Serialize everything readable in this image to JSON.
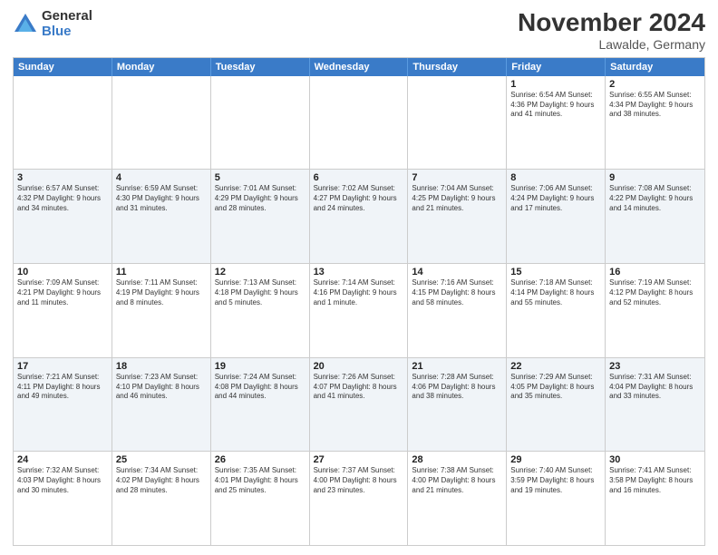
{
  "logo": {
    "general": "General",
    "blue": "Blue"
  },
  "header": {
    "month": "November 2024",
    "location": "Lawalde, Germany"
  },
  "weekdays": [
    "Sunday",
    "Monday",
    "Tuesday",
    "Wednesday",
    "Thursday",
    "Friday",
    "Saturday"
  ],
  "rows": [
    {
      "alt": false,
      "cells": [
        {
          "day": "",
          "info": ""
        },
        {
          "day": "",
          "info": ""
        },
        {
          "day": "",
          "info": ""
        },
        {
          "day": "",
          "info": ""
        },
        {
          "day": "",
          "info": ""
        },
        {
          "day": "1",
          "info": "Sunrise: 6:54 AM\nSunset: 4:36 PM\nDaylight: 9 hours and 41 minutes."
        },
        {
          "day": "2",
          "info": "Sunrise: 6:55 AM\nSunset: 4:34 PM\nDaylight: 9 hours and 38 minutes."
        }
      ]
    },
    {
      "alt": true,
      "cells": [
        {
          "day": "3",
          "info": "Sunrise: 6:57 AM\nSunset: 4:32 PM\nDaylight: 9 hours and 34 minutes."
        },
        {
          "day": "4",
          "info": "Sunrise: 6:59 AM\nSunset: 4:30 PM\nDaylight: 9 hours and 31 minutes."
        },
        {
          "day": "5",
          "info": "Sunrise: 7:01 AM\nSunset: 4:29 PM\nDaylight: 9 hours and 28 minutes."
        },
        {
          "day": "6",
          "info": "Sunrise: 7:02 AM\nSunset: 4:27 PM\nDaylight: 9 hours and 24 minutes."
        },
        {
          "day": "7",
          "info": "Sunrise: 7:04 AM\nSunset: 4:25 PM\nDaylight: 9 hours and 21 minutes."
        },
        {
          "day": "8",
          "info": "Sunrise: 7:06 AM\nSunset: 4:24 PM\nDaylight: 9 hours and 17 minutes."
        },
        {
          "day": "9",
          "info": "Sunrise: 7:08 AM\nSunset: 4:22 PM\nDaylight: 9 hours and 14 minutes."
        }
      ]
    },
    {
      "alt": false,
      "cells": [
        {
          "day": "10",
          "info": "Sunrise: 7:09 AM\nSunset: 4:21 PM\nDaylight: 9 hours and 11 minutes."
        },
        {
          "day": "11",
          "info": "Sunrise: 7:11 AM\nSunset: 4:19 PM\nDaylight: 9 hours and 8 minutes."
        },
        {
          "day": "12",
          "info": "Sunrise: 7:13 AM\nSunset: 4:18 PM\nDaylight: 9 hours and 5 minutes."
        },
        {
          "day": "13",
          "info": "Sunrise: 7:14 AM\nSunset: 4:16 PM\nDaylight: 9 hours and 1 minute."
        },
        {
          "day": "14",
          "info": "Sunrise: 7:16 AM\nSunset: 4:15 PM\nDaylight: 8 hours and 58 minutes."
        },
        {
          "day": "15",
          "info": "Sunrise: 7:18 AM\nSunset: 4:14 PM\nDaylight: 8 hours and 55 minutes."
        },
        {
          "day": "16",
          "info": "Sunrise: 7:19 AM\nSunset: 4:12 PM\nDaylight: 8 hours and 52 minutes."
        }
      ]
    },
    {
      "alt": true,
      "cells": [
        {
          "day": "17",
          "info": "Sunrise: 7:21 AM\nSunset: 4:11 PM\nDaylight: 8 hours and 49 minutes."
        },
        {
          "day": "18",
          "info": "Sunrise: 7:23 AM\nSunset: 4:10 PM\nDaylight: 8 hours and 46 minutes."
        },
        {
          "day": "19",
          "info": "Sunrise: 7:24 AM\nSunset: 4:08 PM\nDaylight: 8 hours and 44 minutes."
        },
        {
          "day": "20",
          "info": "Sunrise: 7:26 AM\nSunset: 4:07 PM\nDaylight: 8 hours and 41 minutes."
        },
        {
          "day": "21",
          "info": "Sunrise: 7:28 AM\nSunset: 4:06 PM\nDaylight: 8 hours and 38 minutes."
        },
        {
          "day": "22",
          "info": "Sunrise: 7:29 AM\nSunset: 4:05 PM\nDaylight: 8 hours and 35 minutes."
        },
        {
          "day": "23",
          "info": "Sunrise: 7:31 AM\nSunset: 4:04 PM\nDaylight: 8 hours and 33 minutes."
        }
      ]
    },
    {
      "alt": false,
      "cells": [
        {
          "day": "24",
          "info": "Sunrise: 7:32 AM\nSunset: 4:03 PM\nDaylight: 8 hours and 30 minutes."
        },
        {
          "day": "25",
          "info": "Sunrise: 7:34 AM\nSunset: 4:02 PM\nDaylight: 8 hours and 28 minutes."
        },
        {
          "day": "26",
          "info": "Sunrise: 7:35 AM\nSunset: 4:01 PM\nDaylight: 8 hours and 25 minutes."
        },
        {
          "day": "27",
          "info": "Sunrise: 7:37 AM\nSunset: 4:00 PM\nDaylight: 8 hours and 23 minutes."
        },
        {
          "day": "28",
          "info": "Sunrise: 7:38 AM\nSunset: 4:00 PM\nDaylight: 8 hours and 21 minutes."
        },
        {
          "day": "29",
          "info": "Sunrise: 7:40 AM\nSunset: 3:59 PM\nDaylight: 8 hours and 19 minutes."
        },
        {
          "day": "30",
          "info": "Sunrise: 7:41 AM\nSunset: 3:58 PM\nDaylight: 8 hours and 16 minutes."
        }
      ]
    }
  ]
}
